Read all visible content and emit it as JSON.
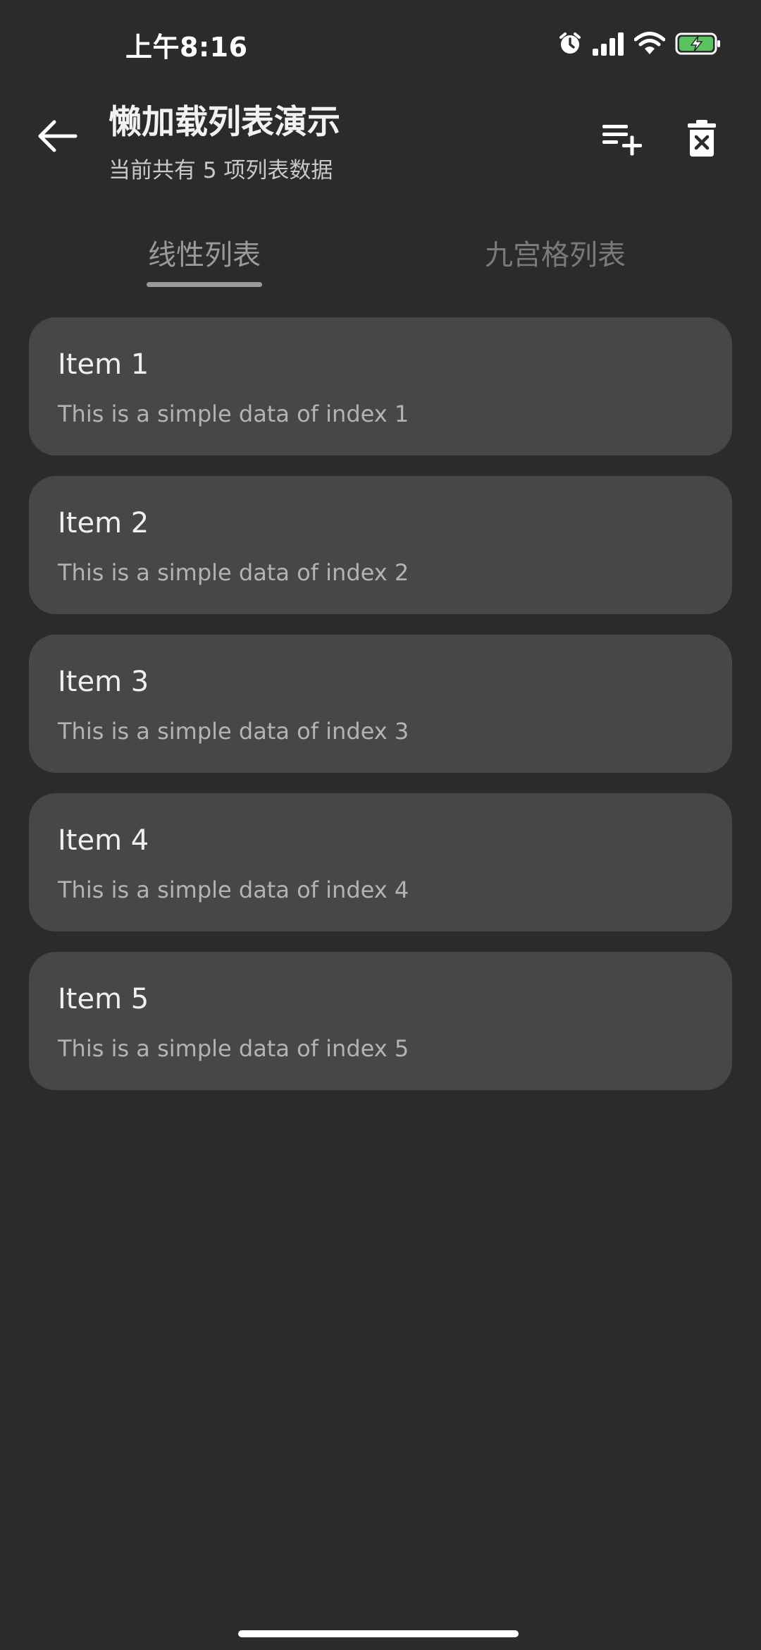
{
  "status_bar": {
    "time": "上午8:16",
    "icons": [
      "alarm-icon",
      "signal-icon",
      "wifi-icon",
      "battery-charging-icon"
    ],
    "battery_color": "#58c35f"
  },
  "app_bar": {
    "title": "懒加载列表演示",
    "subtitle": "当前共有 5 项列表数据",
    "back_icon": "arrow-left-icon",
    "actions": [
      "playlist-add-icon",
      "delete-icon"
    ]
  },
  "tabs": [
    {
      "label": "线性列表",
      "selected": true
    },
    {
      "label": "九宫格列表",
      "selected": false
    }
  ],
  "items": [
    {
      "title": "Item 1",
      "description": "This is a simple data of index 1"
    },
    {
      "title": "Item 2",
      "description": "This is a simple data of index 2"
    },
    {
      "title": "Item 3",
      "description": "This is a simple data of index 3"
    },
    {
      "title": "Item 4",
      "description": "This is a simple data of index 4"
    },
    {
      "title": "Item 5",
      "description": "This is a simple data of index 5"
    }
  ],
  "colors": {
    "background": "#2b2b2b",
    "card": "#474747",
    "tab_indicator": "#9a9a9a"
  }
}
